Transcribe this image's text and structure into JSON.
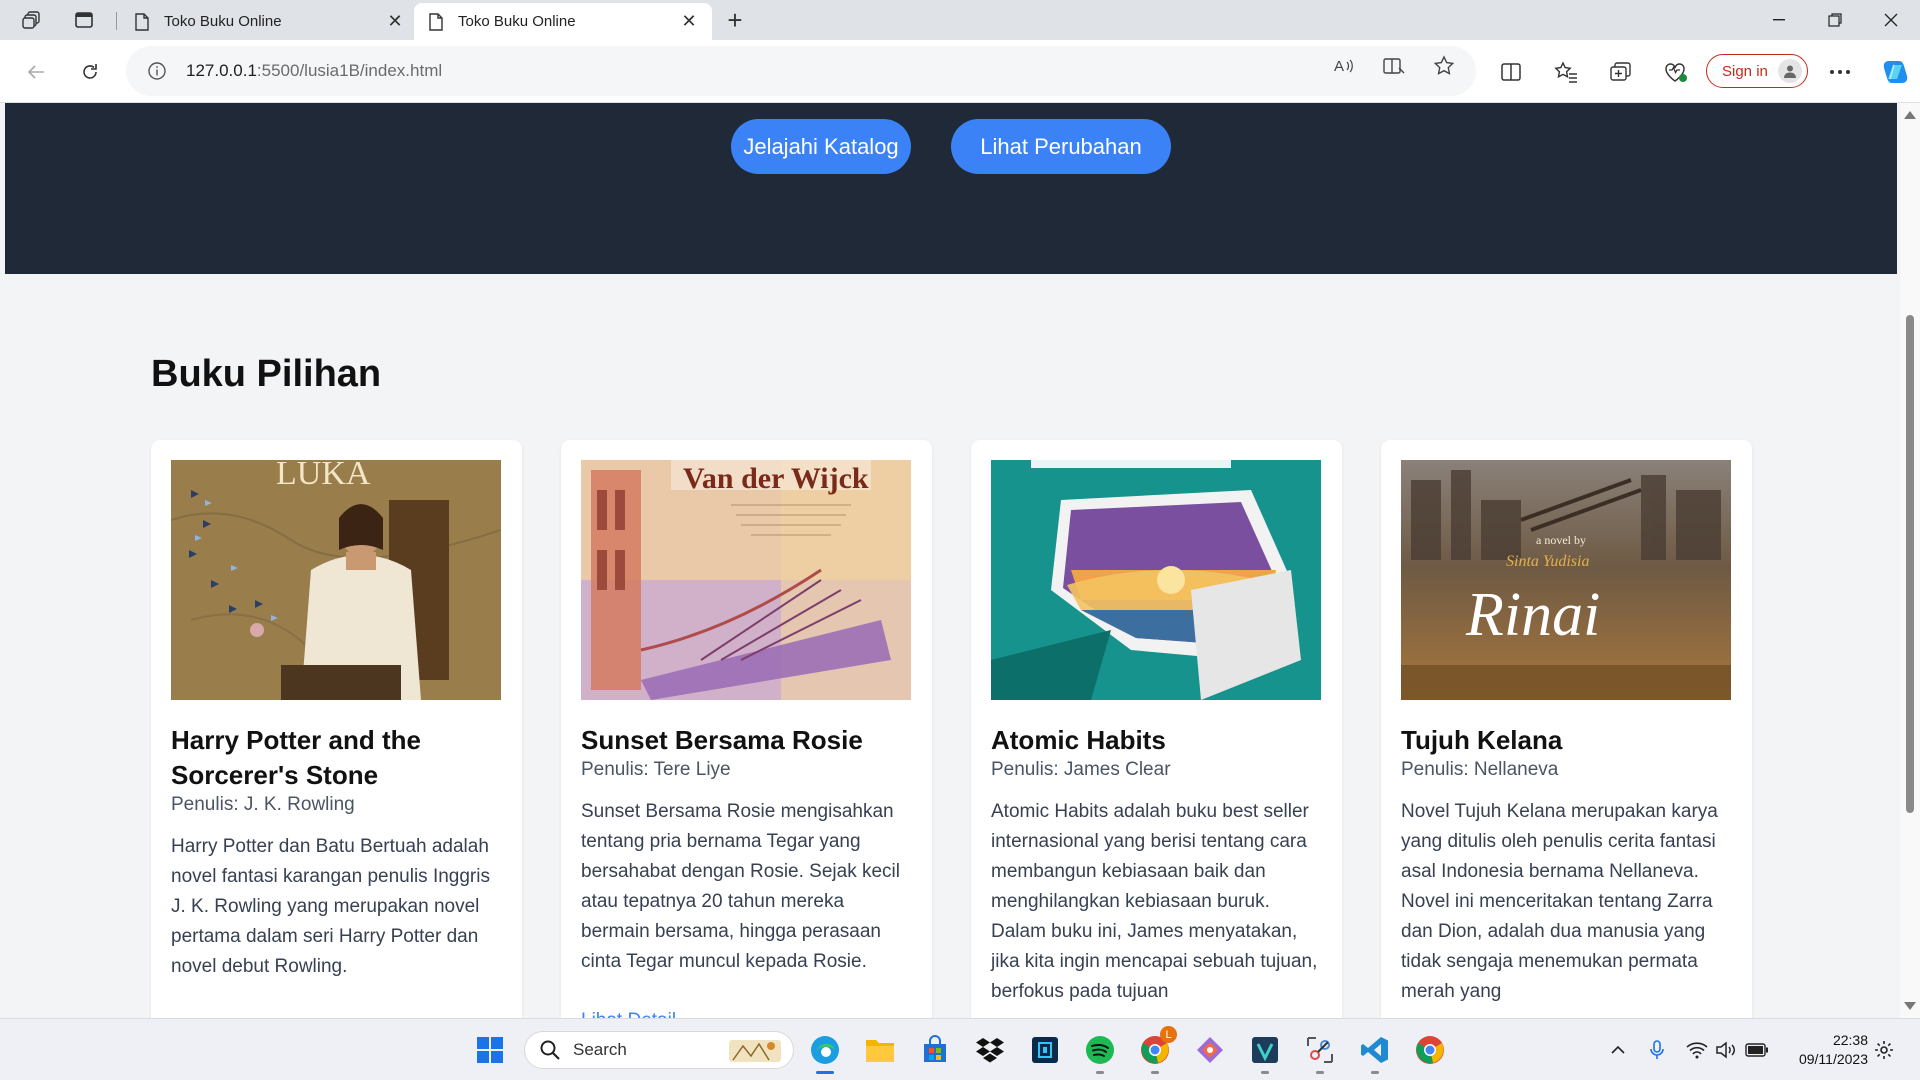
{
  "browser": {
    "tabs": [
      {
        "title": "Toko Buku Online",
        "active": false
      },
      {
        "title": "Toko Buku Online",
        "active": true
      }
    ],
    "url_host": "127.0.0.1",
    "url_rest": ":5500/lusia1B/index.html",
    "signin_label": "Sign in",
    "icons": [
      "workspaces-icon",
      "tab-actions-icon",
      "back-icon",
      "refresh-icon",
      "site-info-icon",
      "read-aloud-icon",
      "immersive-reader-icon",
      "favorite-star-icon",
      "split-screen-icon",
      "favorites-icon",
      "collections-icon",
      "browser-essentials-icon",
      "more-icon",
      "copilot-icon"
    ]
  },
  "hero": {
    "buttons": [
      {
        "label": "Jelajahi Katalog"
      },
      {
        "label": "Lihat Perubahan"
      }
    ]
  },
  "section": {
    "title": "Buku Pilihan"
  },
  "books": [
    {
      "title": "Harry Potter and the Sorcerer's Stone",
      "author": "Penulis: J. K. Rowling",
      "description": "Harry Potter dan Batu Bertuah adalah novel fantasi karangan penulis Inggris J. K. Rowling yang merupakan novel pertama dalam seri Harry Potter dan novel debut Rowling.",
      "cover_text": "LUKA",
      "cover_colors": [
        "#a88b55",
        "#6b5430"
      ]
    },
    {
      "title": "Sunset Bersama Rosie",
      "author": "Penulis: Tere Liye",
      "description": "Sunset Bersama Rosie mengisahkan tentang pria bernama Tegar yang bersahabat dengan Rosie. Sejak kecil atau tepatnya 20 tahun mereka bermain bersama, hingga perasaan cinta Tegar muncul kepada Rosie.",
      "detail_label": "Lihat Detail",
      "cover_text": "Van der Wijck",
      "cover_colors": [
        "#e9c9a8",
        "#9c6fb6"
      ]
    },
    {
      "title": "Atomic Habits",
      "author": "Penulis: James Clear",
      "description": "Atomic Habits adalah buku best seller internasional yang berisi tentang cara membangun kebiasaan baik dan menghilangkan kebiasaan buruk. Dalam buku ini, James menyatakan, jika kita ingin mencapai sebuah tujuan, berfokus pada tujuan",
      "cover_colors": [
        "#1aa39b",
        "#0c6f6a"
      ]
    },
    {
      "title": "Tujuh Kelana",
      "author": "Penulis: Nellaneva",
      "description": "Novel Tujuh Kelana merupakan karya yang ditulis oleh penulis cerita fantasi asal Indonesia bernama Nellaneva. Novel ini menceritakan tentang Zarra dan Dion, adalah dua manusia yang tidak sengaja menemukan permata merah yang",
      "cover_text": "Rinai",
      "cover_small": "a novel by",
      "cover_author": "Sinta Yudisia",
      "cover_colors": [
        "#6e5a44",
        "#3b2f25"
      ]
    }
  ],
  "taskbar": {
    "search_label": "Search",
    "apps": [
      "start-icon",
      "edge-icon",
      "file-explorer-icon",
      "microsoft-store-icon",
      "dropbox-icon",
      "app-icon",
      "spotify-icon",
      "chrome-profile-icon",
      "git-icon",
      "app-icon",
      "snipping-tool-icon",
      "vscode-icon",
      "chrome-icon"
    ],
    "chrome_badge": "L",
    "time": "22:38",
    "date": "09/11/2023"
  }
}
